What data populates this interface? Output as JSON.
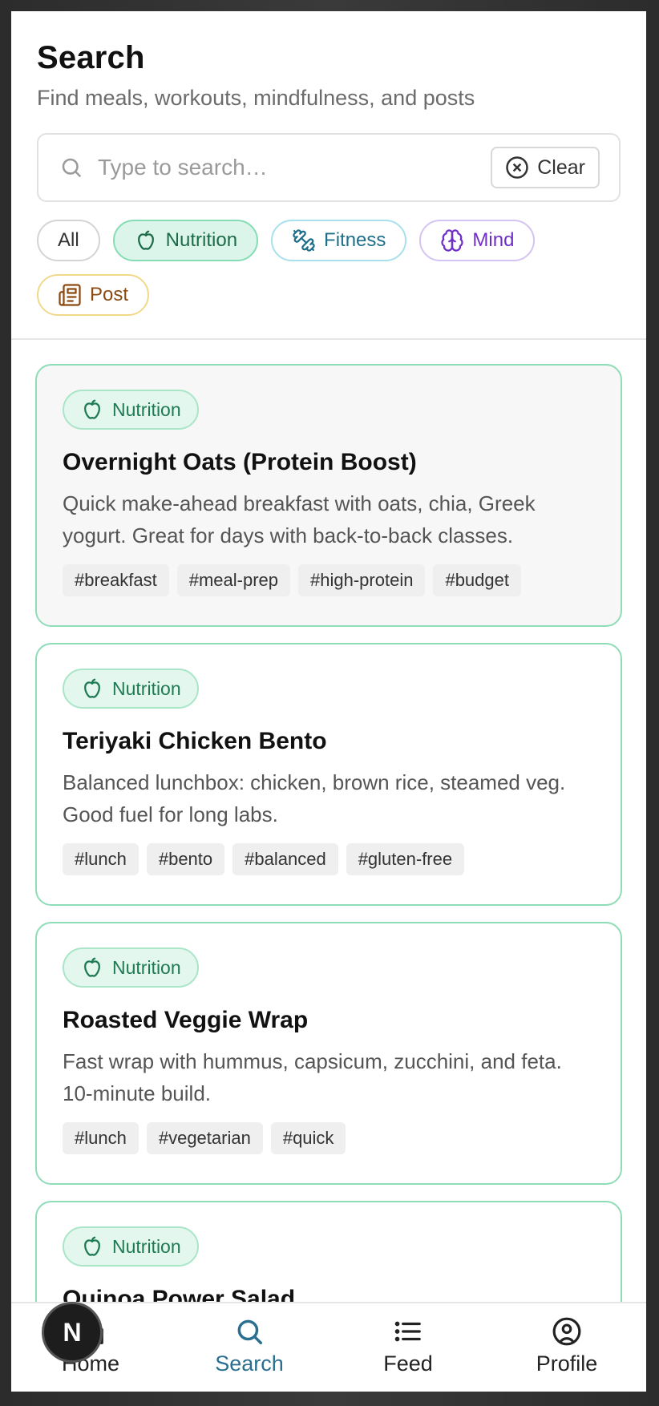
{
  "header": {
    "title": "Search",
    "subtitle": "Find meals, workouts, mindfulness, and posts"
  },
  "search": {
    "placeholder": "Type to search…",
    "value": "",
    "clear_label": "Clear"
  },
  "filters": [
    {
      "label": "All",
      "icon": null,
      "selected": false
    },
    {
      "label": "Nutrition",
      "icon": "apple-icon",
      "selected": true
    },
    {
      "label": "Fitness",
      "icon": "dumbbell-icon",
      "selected": false
    },
    {
      "label": "Mind",
      "icon": "brain-icon",
      "selected": false
    },
    {
      "label": "Post",
      "icon": "newspaper-icon",
      "selected": false
    }
  ],
  "results": [
    {
      "category": "Nutrition",
      "title": "Overnight Oats (Protein Boost)",
      "description": "Quick make-ahead breakfast with oats, chia, Greek yogurt. Great for days with back-to-back classes.",
      "tags": [
        "#breakfast",
        "#meal-prep",
        "#high-protein",
        "#budget"
      ]
    },
    {
      "category": "Nutrition",
      "title": "Teriyaki Chicken Bento",
      "description": "Balanced lunchbox: chicken, brown rice, steamed veg. Good fuel for long labs.",
      "tags": [
        "#lunch",
        "#bento",
        "#balanced",
        "#gluten-free"
      ]
    },
    {
      "category": "Nutrition",
      "title": "Roasted Veggie Wrap",
      "description": "Fast wrap with hummus, capsicum, zucchini, and feta. 10-minute build.",
      "tags": [
        "#lunch",
        "#vegetarian",
        "#quick"
      ]
    },
    {
      "category": "Nutrition",
      "title": "Quinoa Power Salad",
      "description": "",
      "tags": []
    }
  ],
  "nav": {
    "items": [
      {
        "label": "Home",
        "icon": "home-icon"
      },
      {
        "label": "Search",
        "icon": "search-icon"
      },
      {
        "label": "Feed",
        "icon": "list-icon"
      },
      {
        "label": "Profile",
        "icon": "user-circle-icon"
      }
    ],
    "active": "Search"
  },
  "overlay": {
    "avatar_letter": "N"
  },
  "colors": {
    "nutrition_accent": "#1e7a52",
    "nutrition_border": "#8fdcb8",
    "fitness_accent": "#1e6f8a",
    "mind_accent": "#6f2fc7",
    "post_accent": "#8a4a12",
    "active_nav": "#2a6f8f"
  }
}
